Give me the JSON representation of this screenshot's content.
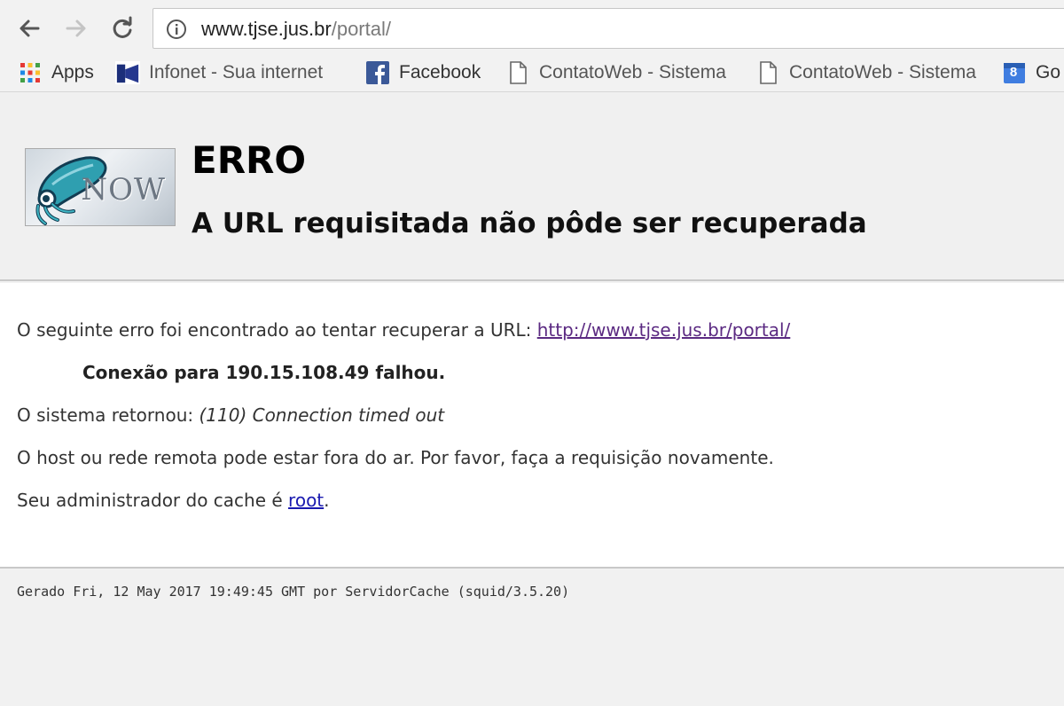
{
  "browser": {
    "address_host": "www.tjse.jus.br",
    "address_path": "/portal/",
    "bookmarks": [
      {
        "label": "Apps",
        "icon": "apps-grid-icon"
      },
      {
        "label": "Infonet - Sua internet",
        "icon": "infonet-icon"
      },
      {
        "label": "Facebook",
        "icon": "facebook-icon"
      },
      {
        "label": "ContatoWeb - Sistema",
        "icon": "page-icon"
      },
      {
        "label": "ContatoWeb - Sistema",
        "icon": "page-icon"
      },
      {
        "label": "Go",
        "icon": "calendar-icon",
        "badge": "8"
      }
    ]
  },
  "logo": {
    "text": "NOW"
  },
  "page": {
    "title": "ERRO",
    "subtitle": "A URL requisitada não pôde ser recuperada",
    "intro_text": "O seguinte erro foi encontrado ao tentar recuperar a URL: ",
    "intro_link": "http://www.tjse.jus.br/portal/",
    "connection_error": "Conexão para 190.15.108.49 falhou.",
    "system_prefix": "O sistema retornou: ",
    "system_message": "(110) Connection timed out",
    "remote_note": "O host ou rede remota pode estar fora do ar. Por favor, faça a requisição novamente.",
    "admin_prefix": "Seu administrador do cache é ",
    "admin_link": "root",
    "admin_suffix": ".",
    "footer": "Gerado Fri, 12 May 2017 19:49:45 GMT por ServidorCache (squid/3.5.20)"
  }
}
